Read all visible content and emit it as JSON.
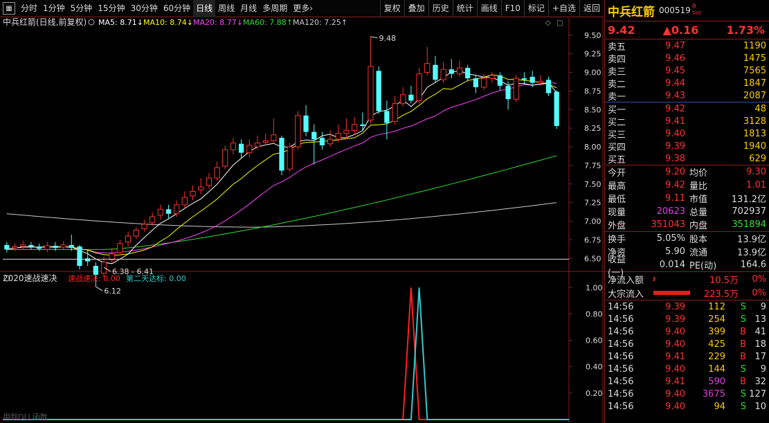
{
  "toolbar": {
    "icon": "grid-icon",
    "periods": [
      "分时",
      "1分钟",
      "5分钟",
      "15分钟",
      "30分钟",
      "60分钟",
      "日线",
      "周线",
      "月线",
      "多周期",
      "更多"
    ],
    "active": "日线",
    "more_arrow": "›",
    "actions": [
      "复权",
      "叠加",
      "历史",
      "统计",
      "画线",
      "F10",
      "标记",
      "+自选",
      "返回"
    ]
  },
  "stock": {
    "name": "中兵红箭",
    "code": "000519",
    "r_mark": "R",
    "r_sub": "500",
    "price": "9.42",
    "change": "▲0.16",
    "pct": "1.73%"
  },
  "orderbook": {
    "sell": [
      {
        "label": "卖五",
        "price": "9.47",
        "vol": "1190"
      },
      {
        "label": "卖四",
        "price": "9.46",
        "vol": "1475"
      },
      {
        "label": "卖三",
        "price": "9.45",
        "vol": "7565"
      },
      {
        "label": "卖二",
        "price": "9.44",
        "vol": "1847"
      },
      {
        "label": "卖一",
        "price": "9.43",
        "vol": "2087"
      }
    ],
    "buy": [
      {
        "label": "买一",
        "price": "9.42",
        "vol": "48"
      },
      {
        "label": "买二",
        "price": "9.41",
        "vol": "3128"
      },
      {
        "label": "买三",
        "price": "9.40",
        "vol": "1813"
      },
      {
        "label": "买四",
        "price": "9.39",
        "vol": "1940"
      },
      {
        "label": "买五",
        "price": "9.38",
        "vol": "629"
      }
    ]
  },
  "stats1": [
    {
      "k": "今开",
      "v": "9.20",
      "c1": "#ff3232",
      "k2": "均价",
      "v2": "9.30",
      "c2": "#ff3232"
    },
    {
      "k": "最高",
      "v": "9.42",
      "c1": "#ff3232",
      "k2": "量比",
      "v2": "1.01",
      "c2": "#ff3232"
    },
    {
      "k": "最低",
      "v": "9.11",
      "c1": "#ff3232",
      "k2": "市值",
      "v2": "131.2亿",
      "c2": "#ddd"
    },
    {
      "k": "现量",
      "v": "20623",
      "c1": "#e040e0",
      "k2": "总量",
      "v2": "702937",
      "c2": "#ddd"
    },
    {
      "k": "外盘",
      "v": "351043",
      "c1": "#ff3232",
      "k2": "内盘",
      "v2": "351894",
      "c2": "#33dd33"
    }
  ],
  "stats2": [
    {
      "k": "换手",
      "v": "5.05%",
      "c1": "#ddd",
      "k2": "股本",
      "v2": "13.9亿",
      "c2": "#ddd"
    },
    {
      "k": "净资",
      "v": "5.90",
      "c1": "#ddd",
      "k2": "流通",
      "v2": "13.9亿",
      "c2": "#ddd"
    },
    {
      "k": "收益(一)",
      "v": "0.014",
      "c1": "#ddd",
      "k2": "PE(动)",
      "v2": "164.6",
      "c2": "#ddd"
    }
  ],
  "flow": [
    {
      "k": "净流入额",
      "bar": 0.03,
      "amt": "10.5万",
      "pct": "0%"
    },
    {
      "k": "大宗流入",
      "bar": 0.95,
      "amt": "223.5万",
      "pct": "0%"
    }
  ],
  "ticks": [
    {
      "t": "14:56",
      "p": "9.39",
      "v": "112",
      "vc": "#ffcc00",
      "d": "S",
      "dc": "#33dd33",
      "c": "9"
    },
    {
      "t": "14:56",
      "p": "9.39",
      "v": "254",
      "vc": "#ffcc00",
      "d": "S",
      "dc": "#33dd33",
      "c": "13"
    },
    {
      "t": "14:56",
      "p": "9.40",
      "v": "399",
      "vc": "#ffcc00",
      "d": "B",
      "dc": "#ff3232",
      "c": "41"
    },
    {
      "t": "14:56",
      "p": "9.40",
      "v": "425",
      "vc": "#ffcc00",
      "d": "B",
      "dc": "#ff3232",
      "c": "18"
    },
    {
      "t": "14:56",
      "p": "9.41",
      "v": "229",
      "vc": "#ffcc00",
      "d": "B",
      "dc": "#ff3232",
      "c": "17"
    },
    {
      "t": "14:56",
      "p": "9.40",
      "v": "144",
      "vc": "#ffcc00",
      "d": "S",
      "dc": "#33dd33",
      "c": "9"
    },
    {
      "t": "14:56",
      "p": "9.41",
      "v": "590",
      "vc": "#e040e0",
      "d": "B",
      "dc": "#ff3232",
      "c": "32"
    },
    {
      "t": "14:56",
      "p": "9.40",
      "v": "3675",
      "vc": "#e040e0",
      "d": "S",
      "dc": "#33dd33",
      "c": "127"
    },
    {
      "t": "14:56",
      "p": "9.40",
      "v": "94",
      "vc": "#ffcc00",
      "d": "S",
      "dc": "#33dd33",
      "c": "10"
    }
  ],
  "chart_data": [
    {
      "type": "candlestick",
      "title": "中兵红箭(日线,前复权)",
      "ylim": [
        6.4,
        9.6
      ],
      "yticks": [
        "9.50",
        "9.25",
        "9.00",
        "8.75",
        "8.50",
        "8.25",
        "8.00",
        "7.75",
        "7.50",
        "7.25",
        "7.00",
        "6.75",
        "6.50"
      ],
      "legend": [
        {
          "name": "MA5",
          "value": "8.71",
          "color": "#ffffff",
          "arrow": "↓"
        },
        {
          "name": "MA10",
          "value": "8.74",
          "color": "#ffff00",
          "arrow": "↓"
        },
        {
          "name": "MA20",
          "value": "8.77",
          "color": "#ff44ff",
          "arrow": "↓"
        },
        {
          "name": "MA60",
          "value": "7.88",
          "color": "#33dd33",
          "arrow": "↑"
        },
        {
          "name": "MA120",
          "value": "7.25",
          "color": "#cccccc",
          "arrow": "↑"
        }
      ],
      "annotations": [
        {
          "text": "9.48",
          "value": 9.48,
          "candle": 45
        },
        {
          "text": "6.12",
          "value": 6.12,
          "candle": 11
        },
        {
          "text": "6.38 - 6.41",
          "value": 6.38,
          "candle": 12
        }
      ],
      "candles": [
        [
          6.68,
          6.62,
          6.72,
          6.58
        ],
        [
          6.64,
          6.66,
          6.7,
          6.6
        ],
        [
          6.66,
          6.68,
          6.74,
          6.62
        ],
        [
          6.68,
          6.66,
          6.72,
          6.62
        ],
        [
          6.66,
          6.63,
          6.7,
          6.6
        ],
        [
          6.62,
          6.67,
          6.72,
          6.58
        ],
        [
          6.67,
          6.64,
          6.72,
          6.6
        ],
        [
          6.65,
          6.68,
          6.73,
          6.62
        ],
        [
          6.68,
          6.64,
          6.82,
          6.6
        ],
        [
          6.66,
          6.4,
          6.68,
          6.35
        ],
        [
          6.5,
          6.46,
          6.62,
          6.4
        ],
        [
          6.4,
          6.28,
          6.45,
          6.12
        ],
        [
          6.3,
          6.45,
          6.52,
          6.25
        ],
        [
          6.48,
          6.56,
          6.64,
          6.44
        ],
        [
          6.58,
          6.7,
          6.75,
          6.54
        ],
        [
          6.72,
          6.8,
          6.86,
          6.66
        ],
        [
          6.8,
          6.88,
          6.92,
          6.76
        ],
        [
          6.9,
          6.96,
          7.02,
          6.86
        ],
        [
          6.98,
          7.06,
          7.12,
          6.94
        ],
        [
          7.08,
          7.16,
          7.22,
          7.02
        ],
        [
          7.16,
          7.1,
          7.22,
          7.04
        ],
        [
          7.1,
          7.22,
          7.28,
          7.06
        ],
        [
          7.22,
          7.32,
          7.4,
          7.18
        ],
        [
          7.34,
          7.4,
          7.48,
          7.28
        ],
        [
          7.42,
          7.46,
          7.58,
          7.36
        ],
        [
          7.48,
          7.58,
          7.65,
          7.44
        ],
        [
          7.58,
          7.72,
          7.8,
          7.54
        ],
        [
          7.74,
          7.96,
          8.02,
          7.7
        ],
        [
          7.96,
          8.05,
          8.12,
          7.9
        ],
        [
          8.04,
          7.92,
          8.1,
          7.85
        ],
        [
          7.92,
          8.02,
          8.1,
          7.86
        ],
        [
          8.0,
          8.05,
          8.15,
          7.96
        ],
        [
          8.06,
          8.08,
          8.18,
          8.02
        ],
        [
          8.08,
          8.16,
          8.38,
          8.06
        ],
        [
          8.12,
          7.68,
          8.15,
          7.62
        ],
        [
          7.7,
          8.0,
          8.05,
          7.66
        ],
        [
          8.0,
          8.42,
          8.48,
          7.96
        ],
        [
          8.42,
          8.2,
          8.56,
          8.14
        ],
        [
          8.2,
          8.1,
          8.3,
          7.76
        ],
        [
          8.12,
          8.02,
          8.2,
          7.96
        ],
        [
          8.04,
          8.1,
          8.22,
          8.0
        ],
        [
          8.1,
          8.18,
          8.3,
          8.06
        ],
        [
          8.18,
          8.22,
          8.38,
          8.1
        ],
        [
          8.22,
          8.3,
          8.4,
          8.16
        ],
        [
          8.3,
          8.28,
          8.46,
          8.22
        ],
        [
          8.36,
          9.08,
          9.48,
          8.32
        ],
        [
          9.02,
          8.48,
          9.08,
          8.44
        ],
        [
          8.48,
          8.32,
          8.62,
          8.1
        ],
        [
          8.34,
          8.58,
          8.68,
          8.3
        ],
        [
          8.58,
          8.7,
          8.8,
          8.54
        ],
        [
          8.7,
          8.62,
          8.82,
          8.58
        ],
        [
          8.62,
          8.98,
          9.06,
          8.58
        ],
        [
          9.0,
          9.12,
          9.34,
          8.96
        ],
        [
          9.1,
          8.9,
          9.22,
          8.86
        ],
        [
          8.9,
          9.04,
          9.14,
          8.86
        ],
        [
          9.04,
          8.98,
          9.18,
          8.92
        ],
        [
          8.98,
          9.06,
          9.16,
          8.94
        ],
        [
          9.06,
          8.92,
          9.1,
          8.88
        ],
        [
          8.92,
          8.8,
          8.96,
          8.72
        ],
        [
          8.8,
          8.92,
          8.98,
          8.76
        ],
        [
          8.92,
          8.96,
          9.0,
          8.86
        ],
        [
          8.96,
          8.82,
          9.0,
          8.76
        ],
        [
          8.82,
          8.64,
          8.88,
          8.5
        ],
        [
          8.64,
          8.92,
          8.96,
          8.6
        ],
        [
          8.92,
          8.9,
          9.0,
          8.84
        ],
        [
          8.94,
          8.86,
          9.02,
          8.8
        ],
        [
          8.86,
          8.88,
          8.96,
          8.82
        ],
        [
          8.9,
          8.72,
          8.94,
          8.68
        ],
        [
          8.74,
          8.28,
          8.76,
          8.24
        ]
      ],
      "ma_last": {
        "MA60": 7.88,
        "MA120": 7.25
      }
    },
    {
      "type": "line",
      "title": "2020速战速决",
      "legend": [
        {
          "name": "速战速决",
          "value": "0.00",
          "color": "#ff2020"
        },
        {
          "name": "第二天达标",
          "value": "0.00",
          "color": "#33cccc"
        }
      ],
      "ylim": [
        0,
        1.08
      ],
      "yticks": [
        "1.00",
        "0.80",
        "0.60",
        "0.40",
        "0.20"
      ],
      "series": [
        {
          "name": "速战速决",
          "color": "#ff2020",
          "spike_at": 50
        },
        {
          "name": "第二天达标",
          "color": "#33cccc",
          "spike_at": 51
        }
      ],
      "footer": "用到DLL函数"
    }
  ]
}
